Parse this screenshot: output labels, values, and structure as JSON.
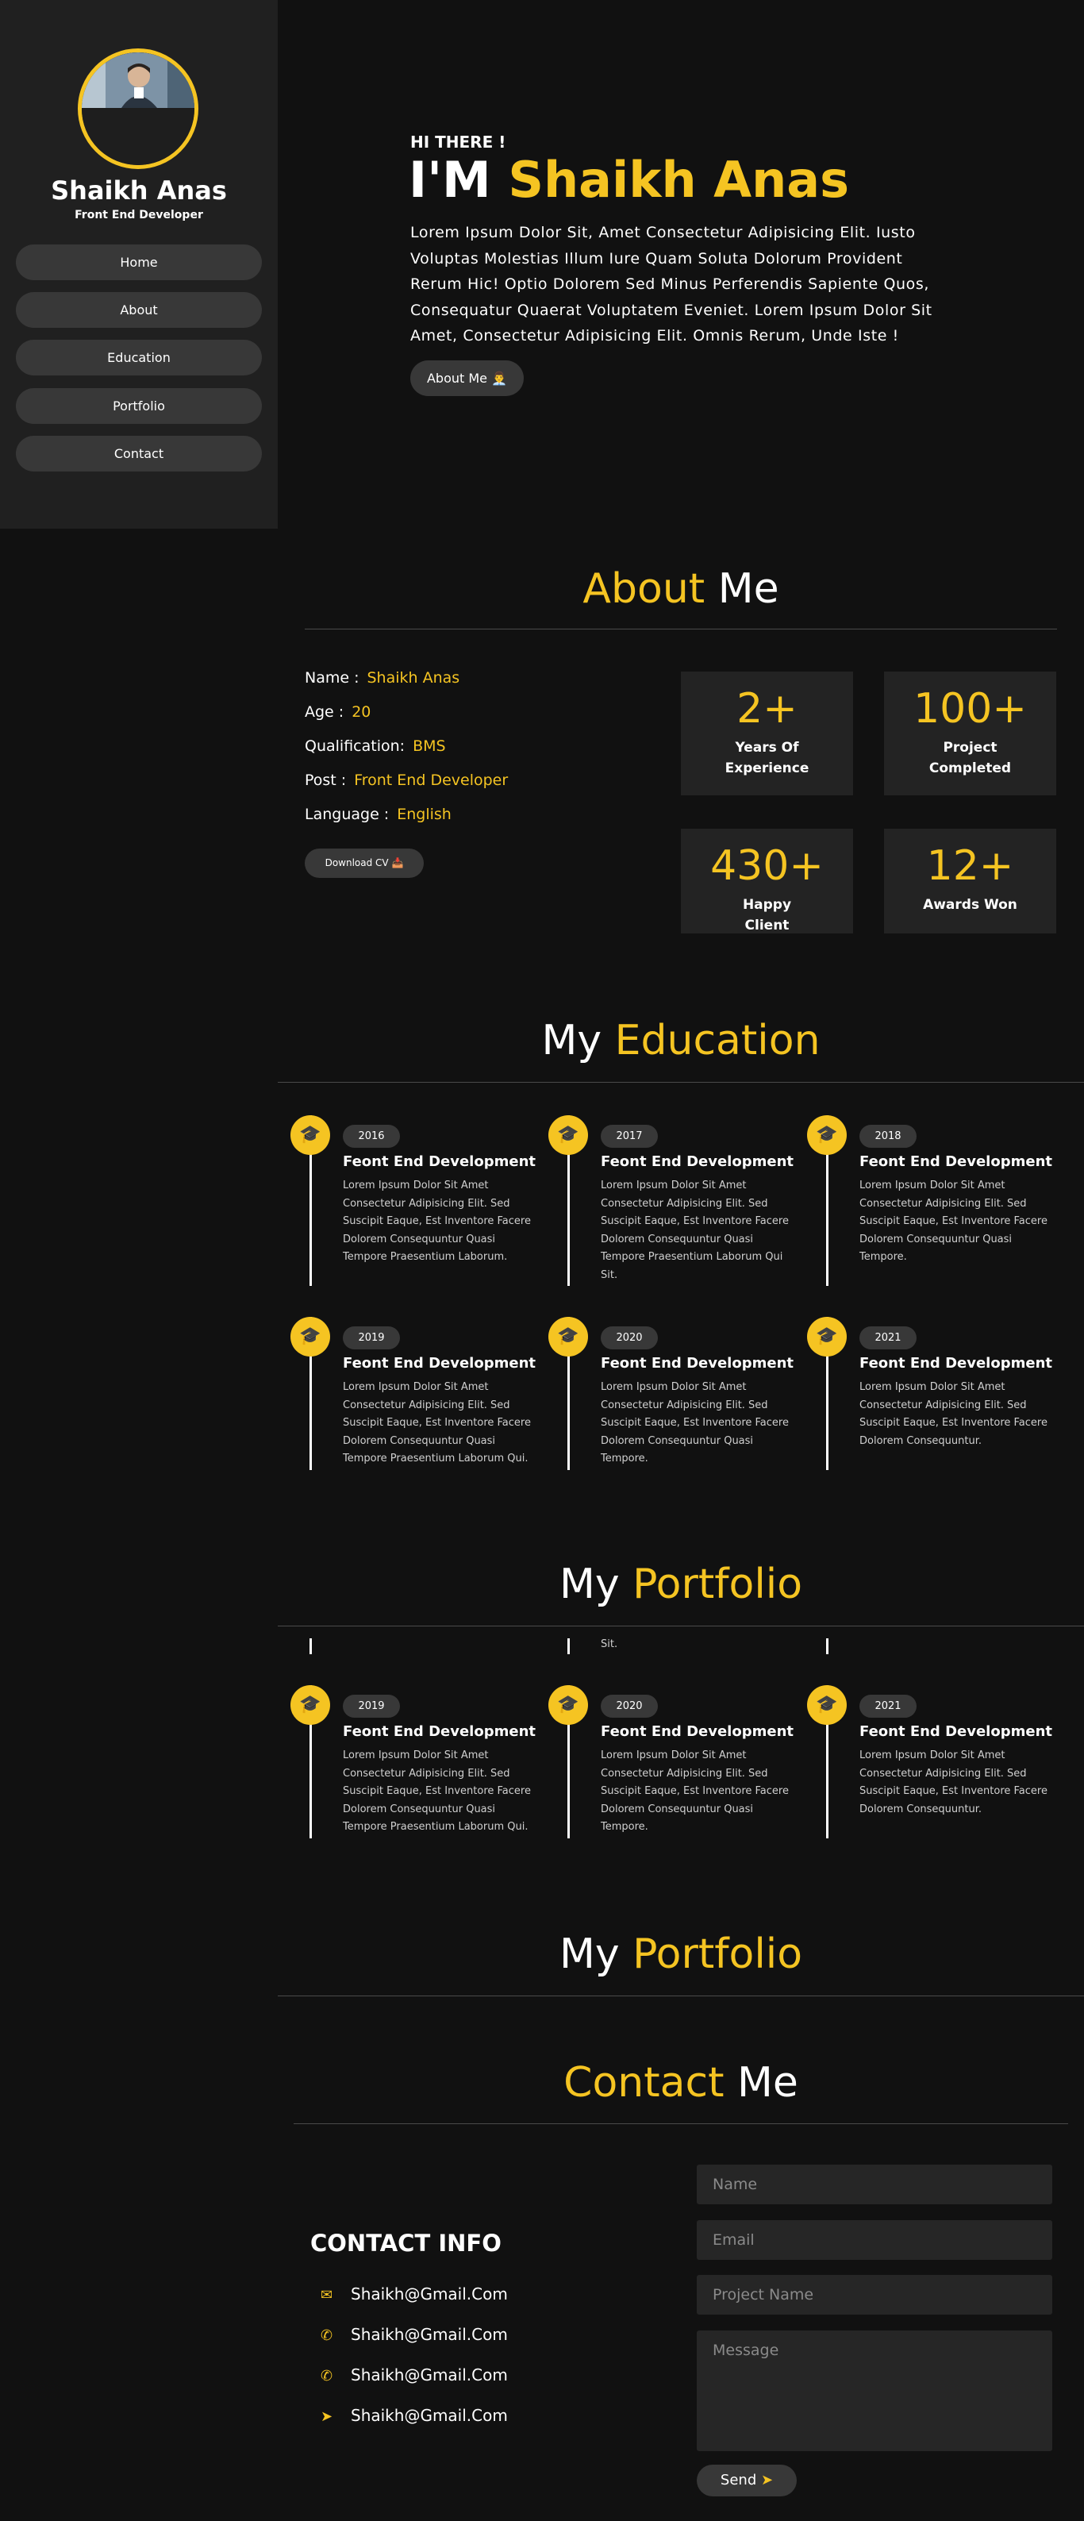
{
  "sidebar": {
    "name": "Shaikh Anas",
    "role": "Front End Developer",
    "nav": [
      "Home",
      "About",
      "Education",
      "Portfolio",
      "Contact"
    ]
  },
  "hero": {
    "greeting": "HI THERE !",
    "title_prefix": "I'M",
    "title_name": "Shaikh Anas",
    "description": "Lorem Ipsum Dolor Sit, Amet Consectetur Adipisicing Elit. Iusto Voluptas Molestias Illum Iure Quam Soluta Dolorum Provident Rerum Hic! Optio Dolorem Sed Minus Perferendis Sapiente Quos, Consequatur Quaerat Voluptatem Eveniet. Lorem Ipsum Dolor Sit Amet, Consectetur Adipisicing Elit. Omnis Rerum, Unde Iste !",
    "button": "About Me 👨‍💼"
  },
  "about": {
    "title_a": "About",
    "title_b": "Me",
    "info": [
      {
        "label": "Name :",
        "value": "Shaikh Anas"
      },
      {
        "label": "Age :",
        "value": "20"
      },
      {
        "label": "Qualification:",
        "value": "BMS"
      },
      {
        "label": "Post :",
        "value": "Front End Developer"
      },
      {
        "label": "Language :",
        "value": "English"
      }
    ],
    "download": "Download CV 📥",
    "stats": [
      {
        "number": "2+",
        "label": "Years Of Experience"
      },
      {
        "number": "100+",
        "label": "Project Completed"
      },
      {
        "number": "430+",
        "label": "Happy Client"
      },
      {
        "number": "12+",
        "label": "Awards Won"
      }
    ]
  },
  "education": {
    "title_a": "My",
    "title_b": "Education",
    "items": [
      {
        "year": "2016",
        "heading": "Feont End Development",
        "text": "Lorem Ipsum Dolor Sit Amet Consectetur Adipisicing Elit. Sed Suscipit Eaque, Est Inventore Facere Dolorem Consequuntur Quasi Tempore Praesentium Laborum."
      },
      {
        "year": "2017",
        "heading": "Feont End Development",
        "text": "Lorem Ipsum Dolor Sit Amet Consectetur Adipisicing Elit. Sed Suscipit Eaque, Est Inventore Facere Dolorem Consequuntur Quasi Tempore Praesentium Laborum Qui Sit."
      },
      {
        "year": "2018",
        "heading": "Feont End Development",
        "text": "Lorem Ipsum Dolor Sit Amet Consectetur Adipisicing Elit. Sed Suscipit Eaque, Est Inventore Facere Dolorem Consequuntur Quasi Tempore."
      },
      {
        "year": "2019",
        "heading": "Feont End Development",
        "text": "Lorem Ipsum Dolor Sit Amet Consectetur Adipisicing Elit. Sed Suscipit Eaque, Est Inventore Facere Dolorem Consequuntur Quasi Tempore Praesentium Laborum Qui."
      },
      {
        "year": "2020",
        "heading": "Feont End Development",
        "text": "Lorem Ipsum Dolor Sit Amet Consectetur Adipisicing Elit. Sed Suscipit Eaque, Est Inventore Facere Dolorem Consequuntur Quasi Tempore."
      },
      {
        "year": "2021",
        "heading": "Feont End Development",
        "text": "Lorem Ipsum Dolor Sit Amet Consectetur Adipisicing Elit. Sed Suscipit Eaque, Est Inventore Facere Dolorem Consequuntur."
      }
    ]
  },
  "portfolio": {
    "title_a": "My",
    "title_b": "Portfolio",
    "overflow_text": "Sit.",
    "items": [
      {
        "year": "2019",
        "heading": "Feont End Development",
        "text": "Lorem Ipsum Dolor Sit Amet Consectetur Adipisicing Elit. Sed Suscipit Eaque, Est Inventore Facere Dolorem Consequuntur Quasi Tempore Praesentium Laborum Qui."
      },
      {
        "year": "2020",
        "heading": "Feont End Development",
        "text": "Lorem Ipsum Dolor Sit Amet Consectetur Adipisicing Elit. Sed Suscipit Eaque, Est Inventore Facere Dolorem Consequuntur Quasi Tempore."
      },
      {
        "year": "2021",
        "heading": "Feont End Development",
        "text": "Lorem Ipsum Dolor Sit Amet Consectetur Adipisicing Elit. Sed Suscipit Eaque, Est Inventore Facere Dolorem Consequuntur."
      }
    ]
  },
  "portfolio2": {
    "title_a": "My",
    "title_b": "Portfolio"
  },
  "contact": {
    "title_a": "Contact",
    "title_b": "Me",
    "info_title": "CONTACT INFO",
    "rows": [
      {
        "icon": "mail-icon",
        "glyph": "✉",
        "text": "Shaikh@Gmail.Com"
      },
      {
        "icon": "phone-icon",
        "glyph": "✆",
        "text": "Shaikh@Gmail.Com"
      },
      {
        "icon": "phone-icon",
        "glyph": "✆",
        "text": "Shaikh@Gmail.Com"
      },
      {
        "icon": "location-arrow-icon",
        "glyph": "➤",
        "text": "Shaikh@Gmail.Com"
      }
    ],
    "form": {
      "name": "Name",
      "email": "Email",
      "project": "Project Name",
      "message": "Message",
      "send": "Send"
    }
  },
  "colors": {
    "accent": "#f5c422",
    "background": "#111111",
    "sidebar": "#202020",
    "card": "#232323",
    "button": "#383838"
  }
}
